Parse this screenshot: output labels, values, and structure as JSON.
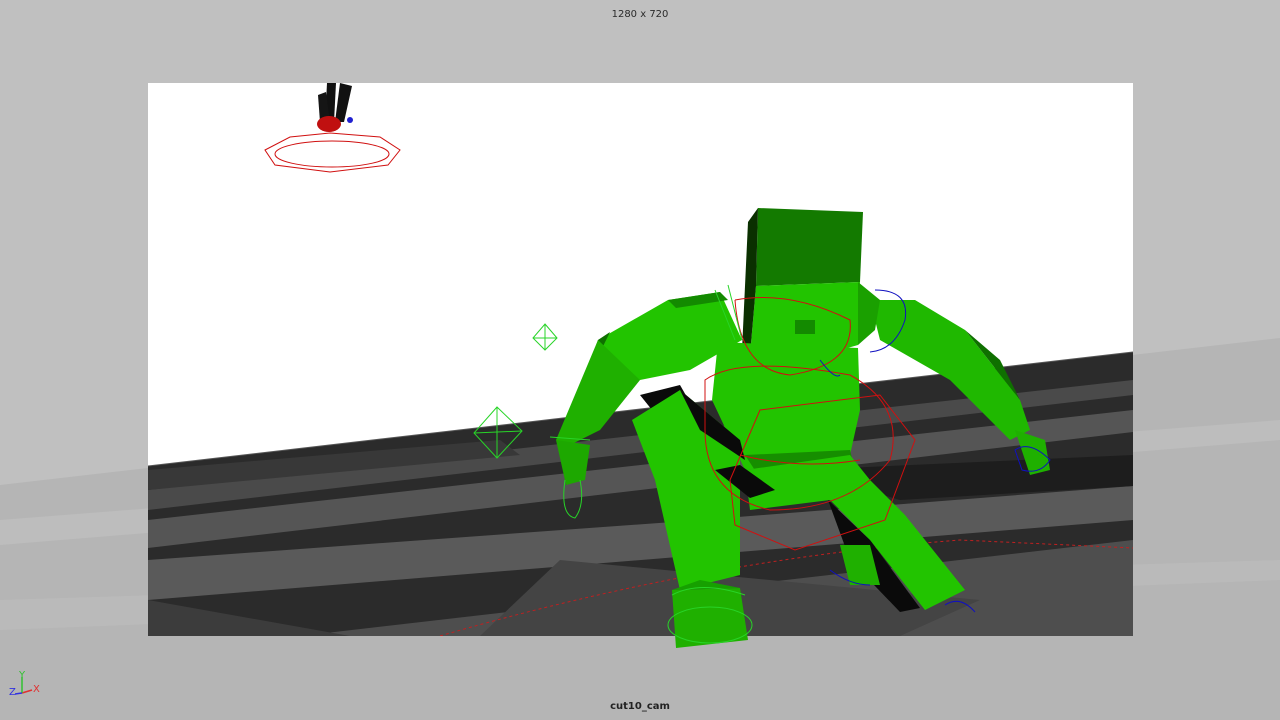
{
  "viewport": {
    "resolution_label": "1280 x 720",
    "camera_name": "cut10_cam"
  },
  "axis_gizmo": {
    "x_label": "X",
    "y_label": "Y",
    "z_label": "Z",
    "x_color": "#e03030",
    "y_color": "#30c030",
    "z_color": "#3030e0"
  },
  "colors": {
    "background": "#c0c0c0",
    "sky": "#ffffff",
    "floor_dark": "#262626",
    "floor_light": "#4c4c4c",
    "mesh_green": "#22c400",
    "mesh_green_dark": "#0f6e00",
    "control_red": "#d01010",
    "control_blue": "#1010c0",
    "wire_green": "#28d428"
  },
  "scene": {
    "character": "green blocky rigged character",
    "secondary_character": "small dark figure with red controls"
  }
}
